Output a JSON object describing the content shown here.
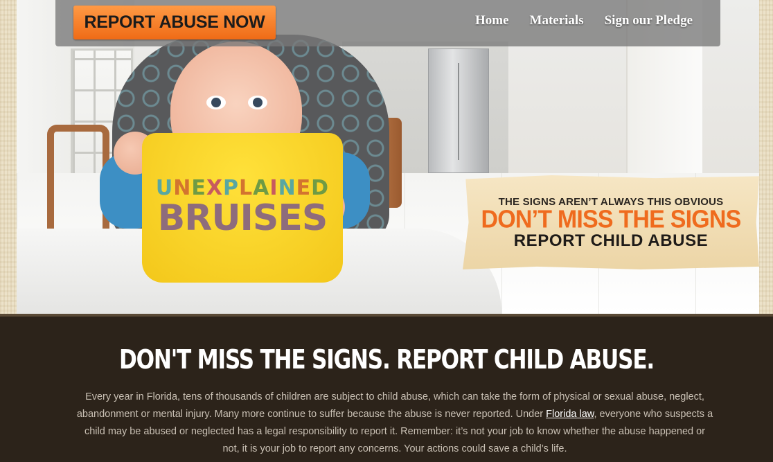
{
  "nav": {
    "report_button": "REPORT ABUSE NOW",
    "links": [
      "Home",
      "Materials",
      "Sign our Pledge"
    ]
  },
  "hero": {
    "bib_line1_letters": [
      "U",
      "N",
      "E",
      "X",
      "P",
      "L",
      "A",
      "I",
      "N",
      "E",
      "D"
    ],
    "bib_line1_colors": [
      "#58a7a2",
      "#d3742f",
      "#6f9b44",
      "#c75a5f",
      "#58a7a2",
      "#d3742f",
      "#6f9b44",
      "#c75a5f",
      "#58a7a2",
      "#d3742f",
      "#6f9b44"
    ],
    "bib_line2": "BRUISES"
  },
  "banner": {
    "line1": "THE SIGNS AREN’T ALWAYS THIS OBVIOUS",
    "line2": "DON’T MISS THE SIGNS",
    "line3": "REPORT CHILD ABUSE"
  },
  "content": {
    "headline": "DON'T MISS THE SIGNS. REPORT CHILD ABUSE.",
    "body_before_link": "Every year in Florida, tens of thousands of children are subject to child abuse, which can take the form of physical or sexual abuse, neglect, abandonment or mental injury. Many more continue to suffer because the abuse is never reported. Under ",
    "link_text": "Florida law",
    "body_after_link": ", everyone who suspects a child may be abused or neglected has a legal responsibility to report it. Remember: it’s not your job to know whether the abuse happened or not, it is your job to report any concerns. Your actions could save a child’s life."
  },
  "colors": {
    "accent_orange": "#ef6b16",
    "dark_section": "#2c231a",
    "bib_yellow": "#f3c71a"
  }
}
